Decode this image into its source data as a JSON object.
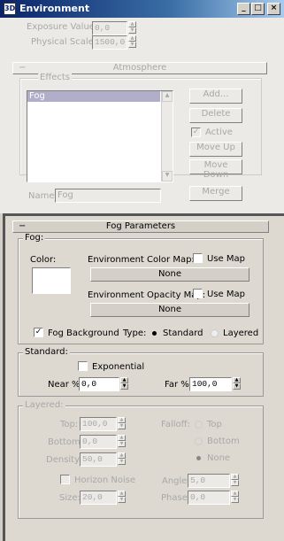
{
  "window": {
    "title": "Environment",
    "icon_text": "3D",
    "minimize": "_",
    "maximize": "□",
    "close": "×"
  },
  "exposure": {
    "value_label": "Exposure Value:",
    "value": "0,0",
    "scale_label": "Physical Scale:",
    "scale": "1500,0"
  },
  "atmosphere": {
    "title": "Atmosphere",
    "effects_label": "Effects",
    "effects": [
      "Fog"
    ],
    "buttons": {
      "add": "Add...",
      "delete": "Delete",
      "move_up": "Move Up",
      "move_down": "Move Down",
      "merge": "Merge"
    },
    "active_label": "Active",
    "name_label": "Name:",
    "name_value": "Fog"
  },
  "fog": {
    "title": "Fog Parameters",
    "group_label": "Fog:",
    "color_label": "Color:",
    "color": "#ffffff",
    "env_color_map_label": "Environment Color Map:",
    "env_opacity_map_label": "Environment Opacity Map:",
    "use_map_label": "Use Map",
    "none": "None",
    "fog_background_label": "Fog Background",
    "type_label": "Type:",
    "type_standard": "Standard",
    "type_layered": "Layered"
  },
  "standard": {
    "group_label": "Standard:",
    "exponential": "Exponential",
    "near_label": "Near %:",
    "near": "0,0",
    "far_label": "Far %:",
    "far": "100,0"
  },
  "layered": {
    "group_label": "Layered:",
    "top_label": "Top:",
    "top": "100,0",
    "bottom_label": "Bottom:",
    "bottom": "0,0",
    "density_label": "Density:",
    "density": "50,0",
    "falloff_label": "Falloff:",
    "falloff_top": "Top",
    "falloff_bottom": "Bottom",
    "falloff_none": "None",
    "horizon_noise": "Horizon Noise",
    "size_label": "Size:",
    "size": "20,0",
    "angle_label": "Angle:",
    "angle": "5,0",
    "phase_label": "Phase:",
    "phase": "0,0"
  }
}
